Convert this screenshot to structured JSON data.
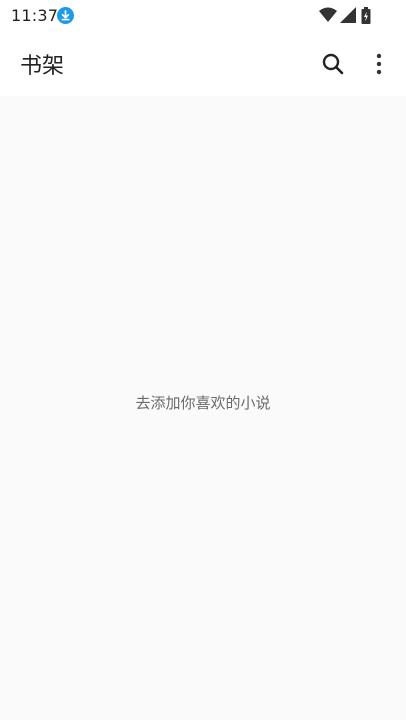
{
  "status_bar": {
    "time": "11:37",
    "icons": [
      "download-icon",
      "wifi-icon",
      "signal-icon",
      "battery-icon"
    ]
  },
  "app_bar": {
    "title": "书架",
    "actions": [
      "search-icon",
      "more-vert-icon"
    ]
  },
  "main": {
    "empty_message": "去添加你喜欢的小说"
  },
  "colors": {
    "download_badge": "#1e9be8",
    "text_primary": "#222222",
    "text_secondary": "#6a6a6a",
    "background": "#fafafa"
  }
}
